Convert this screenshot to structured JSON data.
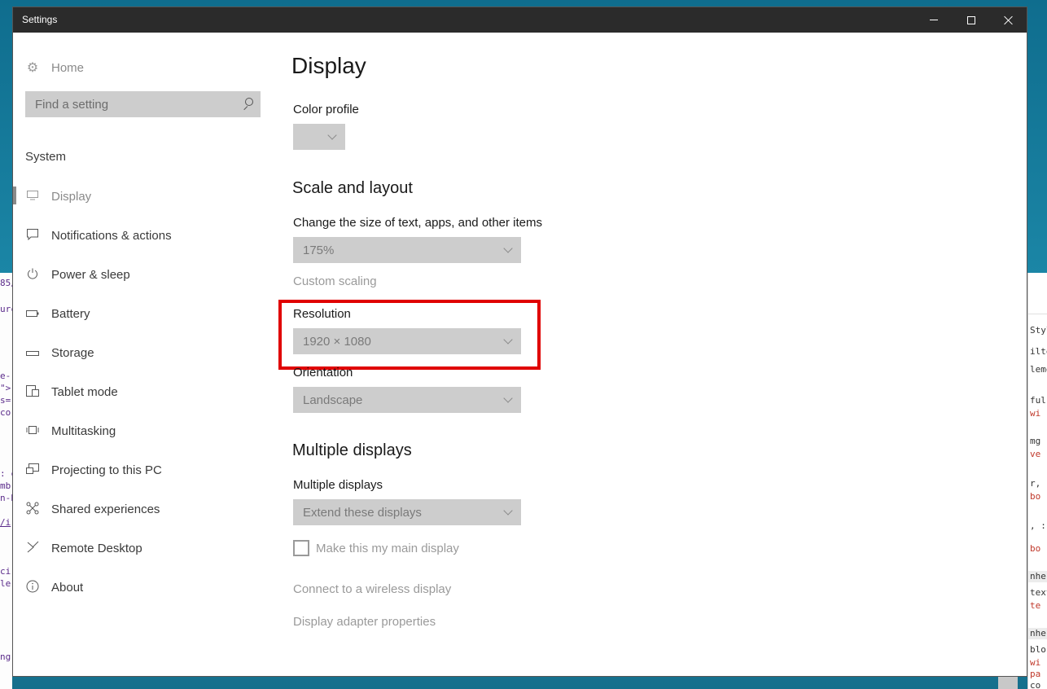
{
  "window": {
    "title": "Settings",
    "controls": {
      "minimize": "minimize-icon",
      "maximize": "maximize-icon",
      "close": "close-icon"
    }
  },
  "sidebar": {
    "home": {
      "label": "Home",
      "icon": "gear-icon"
    },
    "search": {
      "placeholder": "Find a setting",
      "icon": "search-icon"
    },
    "section": "System",
    "items": [
      {
        "label": "Display",
        "icon": "monitor-icon",
        "active": true
      },
      {
        "label": "Notifications & actions",
        "icon": "notification-icon"
      },
      {
        "label": "Power & sleep",
        "icon": "power-icon"
      },
      {
        "label": "Battery",
        "icon": "battery-icon"
      },
      {
        "label": "Storage",
        "icon": "storage-icon"
      },
      {
        "label": "Tablet mode",
        "icon": "tablet-icon"
      },
      {
        "label": "Multitasking",
        "icon": "multitasking-icon"
      },
      {
        "label": "Projecting to this PC",
        "icon": "projecting-icon"
      },
      {
        "label": "Shared experiences",
        "icon": "shared-icon"
      },
      {
        "label": "Remote Desktop",
        "icon": "remote-desktop-icon"
      },
      {
        "label": "About",
        "icon": "info-icon"
      }
    ]
  },
  "main": {
    "title": "Display",
    "color_profile": {
      "label": "Color profile",
      "value": ""
    },
    "scale_layout": {
      "heading": "Scale and layout",
      "size_label": "Change the size of text, apps, and other items",
      "size_value": "175%",
      "custom_scaling": "Custom scaling",
      "resolution_label": "Resolution",
      "resolution_value": "1920 × 1080",
      "orientation_label": "Orientation",
      "orientation_value": "Landscape"
    },
    "multiple_displays": {
      "heading": "Multiple displays",
      "label": "Multiple displays",
      "value": "Extend these displays",
      "main_display_checkbox": "Make this my main display",
      "main_display_checked": false
    },
    "links": {
      "wireless": "Connect to a wireless display",
      "adapter": "Display adapter properties"
    }
  },
  "colors": {
    "highlight": "#e00000",
    "titlebar": "#2b2b2b",
    "dropdown_bg": "#cdcdcd"
  }
}
